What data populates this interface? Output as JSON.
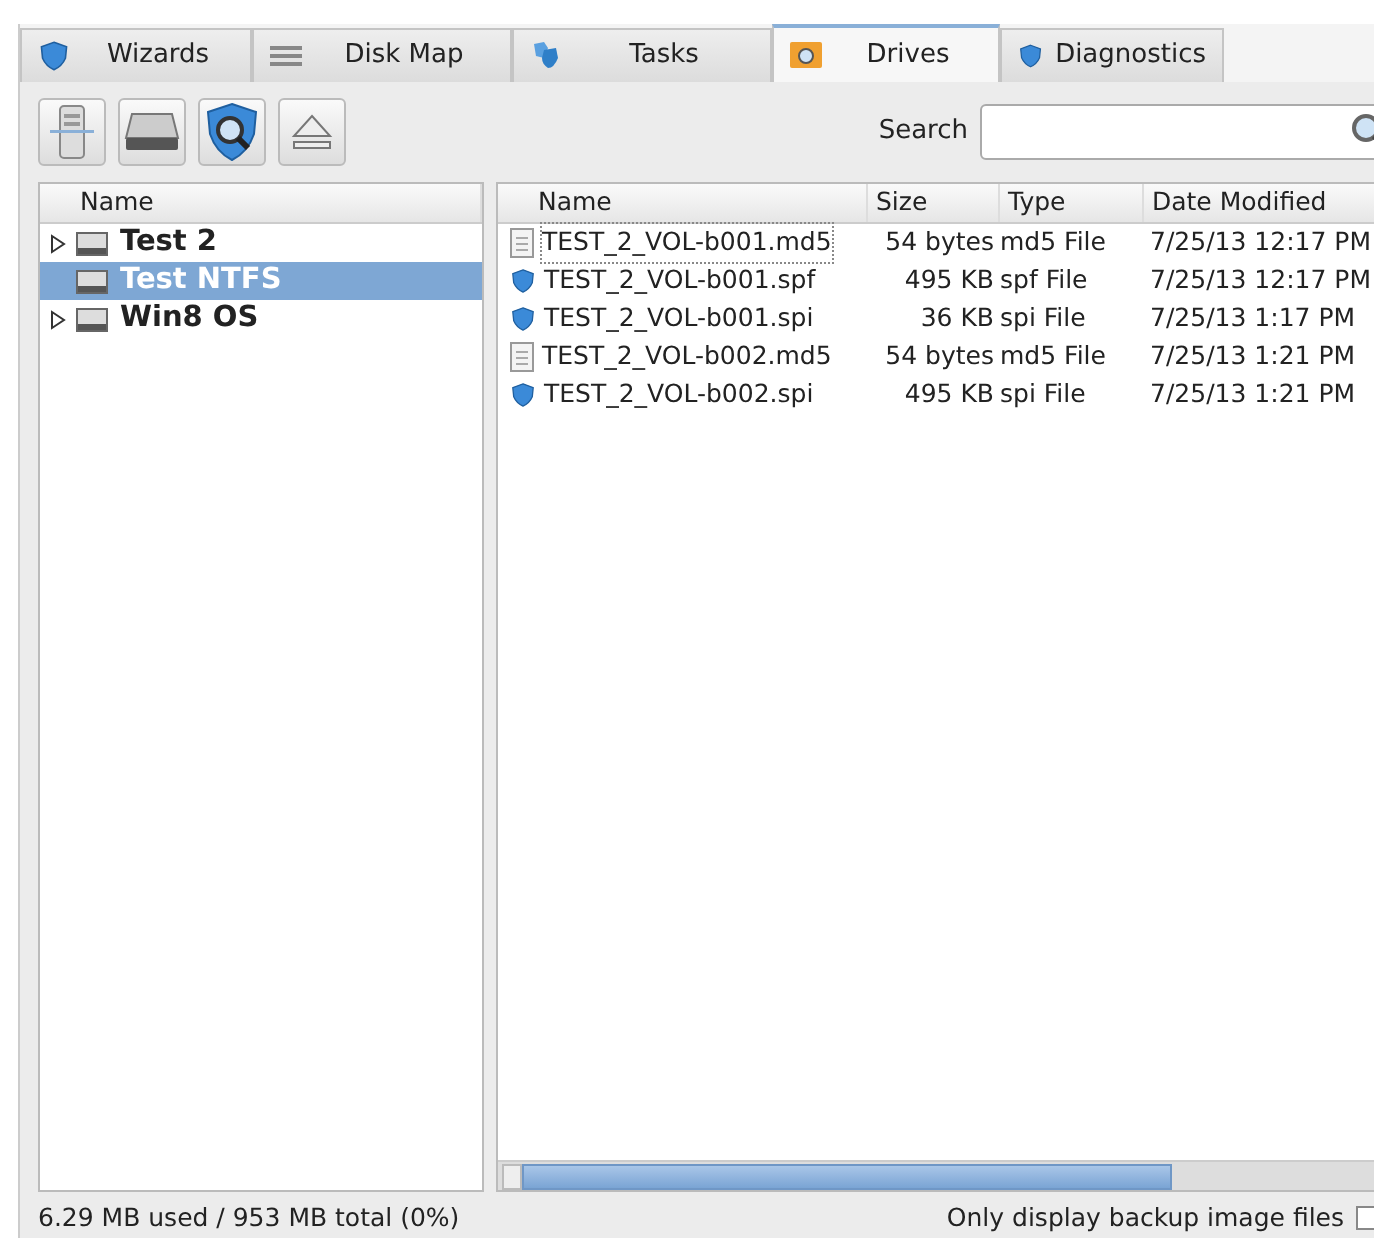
{
  "tabs": [
    {
      "label": "Wizards",
      "kind": "shield",
      "selected": false
    },
    {
      "label": "Disk Map",
      "kind": "lines",
      "selected": false
    },
    {
      "label": "Tasks",
      "kind": "shields",
      "selected": false
    },
    {
      "label": "Drives",
      "kind": "folder",
      "selected": true
    },
    {
      "label": "Diagnostics",
      "kind": "shield",
      "selected": false
    }
  ],
  "toolbar": {
    "buttons": [
      {
        "kind": "server"
      },
      {
        "kind": "drive"
      },
      {
        "kind": "search"
      },
      {
        "kind": "eject"
      }
    ],
    "search_label": "Search"
  },
  "tree": {
    "column": "Name",
    "items": [
      {
        "label": "Test 2",
        "expandable": true,
        "selected": false
      },
      {
        "label": "Test NTFS",
        "expandable": false,
        "selected": true
      },
      {
        "label": "Win8 OS",
        "expandable": true,
        "selected": false
      }
    ]
  },
  "files": {
    "columns": [
      "Name",
      "Size",
      "Type",
      "Date Modified"
    ],
    "rows": [
      {
        "kind": "document",
        "name": "TEST_2_VOL-b001.md5",
        "size": "54 bytes",
        "type": "md5 File",
        "date": "7/25/13 12:17 PM",
        "focused": true
      },
      {
        "kind": "shield",
        "name": "TEST_2_VOL-b001.spf",
        "size": "495 KB",
        "type": "spf File",
        "date": "7/25/13 12:17 PM",
        "focused": false
      },
      {
        "kind": "shield",
        "name": "TEST_2_VOL-b001.spi",
        "size": "36 KB",
        "type": "spi File",
        "date": "7/25/13 1:17 PM",
        "focused": false
      },
      {
        "kind": "document",
        "name": "TEST_2_VOL-b002.md5",
        "size": "54 bytes",
        "type": "md5 File",
        "date": "7/25/13 1:21 PM",
        "focused": false
      },
      {
        "kind": "shield",
        "name": "TEST_2_VOL-b002.spi",
        "size": "495 KB",
        "type": "spi File",
        "date": "7/25/13 1:21 PM",
        "focused": false
      }
    ]
  },
  "status": {
    "usage": "6.29 MB used / 953 MB total (0%)",
    "filter_label": "Only display backup image files",
    "filter_checked": false
  }
}
